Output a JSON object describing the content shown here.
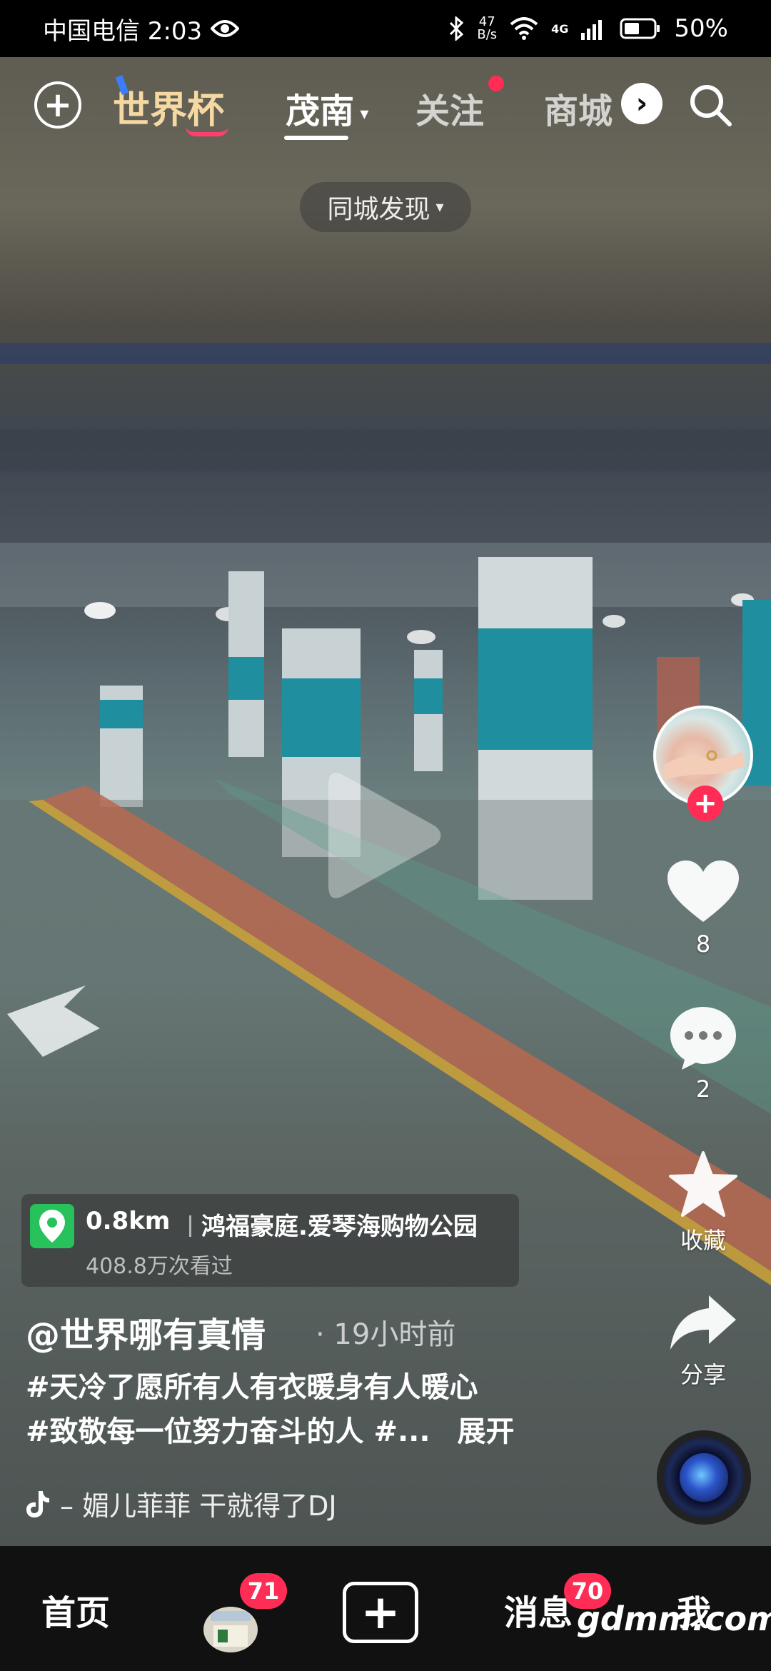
{
  "status_bar": {
    "carrier_time": "中国电信 2:03",
    "net_speed_value": "47",
    "net_speed_unit": "B/s",
    "network": "4G",
    "battery": "50%"
  },
  "top_nav": {
    "logo_text": "世界杯",
    "tabs": [
      {
        "label": "茂南"
      },
      {
        "label": "关注"
      },
      {
        "label": "商城"
      }
    ],
    "city_filter": "同城发现"
  },
  "right_rail": {
    "like_count": "8",
    "comment_count": "2",
    "favorite_label": "收藏",
    "share_label": "分享"
  },
  "poi": {
    "distance": "0.8km",
    "name": "鸿福豪庭.爱琴海购物公园",
    "views": "408.8万次看过"
  },
  "post": {
    "author": "@世界哪有真情",
    "time": "· 19小时前",
    "caption_line1": "#天冷了愿所有人有衣暖身有人暖心",
    "caption_line2": "#致敬每一位努力奋斗的人 #...",
    "expand": "展开",
    "music": "– 媚儿菲菲    干就得了DJ"
  },
  "tab_bar": {
    "home": "首页",
    "friends_badge": "71",
    "messages": "消息",
    "messages_badge": "70",
    "me": "我",
    "watermark": "gdmm.com"
  },
  "colors": {
    "accent_red": "#ff2c55",
    "poi_green": "#27c25c",
    "logo_gold": "#f6d9a2"
  }
}
